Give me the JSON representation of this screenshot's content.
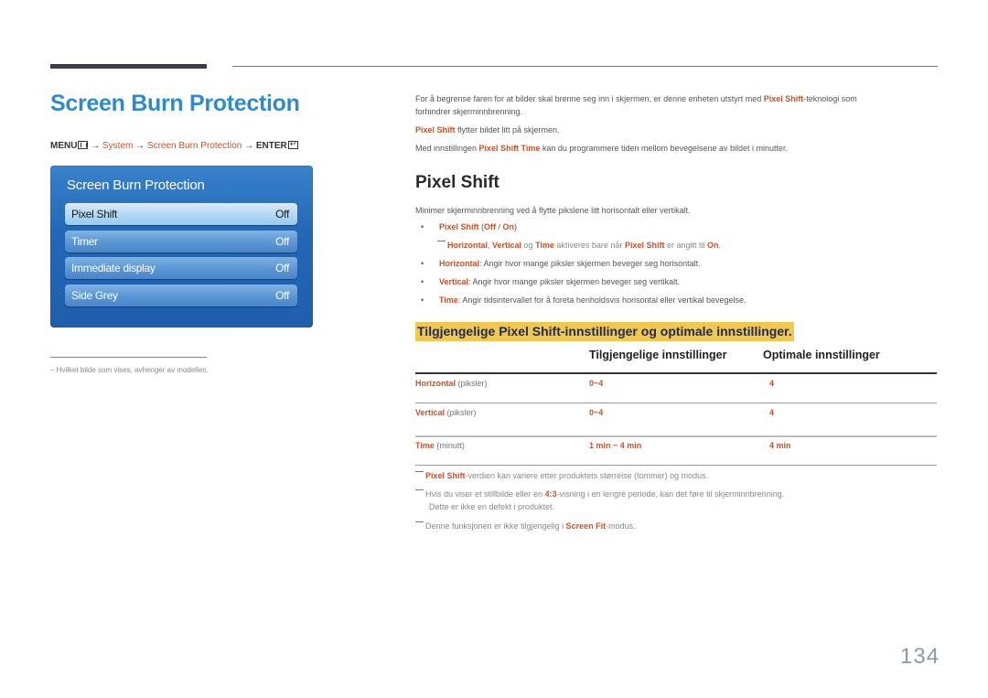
{
  "header": {
    "title": "Screen Burn Protection",
    "menu_path": {
      "menu": "MENU",
      "arrow": "→",
      "system": "System",
      "item": "Screen Burn Protection",
      "enter": "ENTER"
    }
  },
  "osd": {
    "title": "Screen Burn Protection",
    "items": [
      {
        "label": "Pixel Shift",
        "value": "Off",
        "selected": true
      },
      {
        "label": "Timer",
        "value": "Off",
        "selected": false
      },
      {
        "label": "Immediate display",
        "value": "Off",
        "selected": false
      },
      {
        "label": "Side Grey",
        "value": "Off",
        "selected": false
      }
    ]
  },
  "footnote": "Hvilket bilde som vises, avhenger av modellen.",
  "intro": {
    "p1_a": "For å begrense faren for at bilder skal brenne seg inn i skjermen, er denne enheten utstyrt med ",
    "p1_hl": "Pixel Shift",
    "p1_b": "-teknologi som",
    "p1_c": "forhindrer skjerminnbrenning.",
    "p2_hl": "Pixel Shift",
    "p2_b": " flytter bildet litt på skjermen.",
    "p3_a": "Med innstillingen ",
    "p3_hl": "Pixel Shift Time",
    "p3_b": " kan du programmere tiden mellom bevegelsene av bildet i minutter."
  },
  "section": {
    "heading": "Pixel Shift",
    "desc": "Minimer skjerminnbrenning ved å flytte pikslene litt horisontalt eller vertikalt.",
    "option": {
      "name": "Pixel Shift",
      "open": " (",
      "off": "Off",
      "sep": " / ",
      "on": "On",
      "close": ")"
    },
    "note": {
      "h": "Horizontal",
      "c1": ", ",
      "v": "Vertical",
      "og": " og ",
      "t": "Time",
      "mid": " aktiveres bare når ",
      "ps": "Pixel Shift",
      "end": " er angitt til ",
      "on": "On",
      "dot": "."
    },
    "bullets": [
      {
        "term": "Horizontal",
        "text": ": Angir hvor mange piksler skjermen beveger seg horisontalt."
      },
      {
        "term": "Vertical",
        "text": ": Angir hvor mange piksler skjermen beveger seg vertikalt."
      },
      {
        "term": "Time",
        "text": ": Angir tidsintervallet for å foreta henholdsvis horisontal eller vertikal bevegelse."
      }
    ]
  },
  "table": {
    "caption": "Tilgjengelige Pixel Shift-innstillinger og optimale innstillinger.",
    "headers": [
      "",
      "Tilgjengelige innstillinger",
      "Optimale innstillinger"
    ],
    "rows": [
      {
        "name": "Horizontal",
        "unit": " (piksler)",
        "available": "0~4",
        "optimal": "4"
      },
      {
        "name": "Vertical",
        "unit": " (piksler)",
        "available": "0~4",
        "optimal": "4"
      },
      {
        "name": "Time",
        "unit": " (minutt)",
        "available": "1 min ~ 4 min",
        "optimal": "4 min"
      }
    ]
  },
  "notes": {
    "n1_hl": "Pixel Shift",
    "n1_b": "-verdien kan variere etter produktets størrelse (tommer) og modus.",
    "n2_a": "Hvis du viser et stillbilde eller en ",
    "n2_hl": "4:3",
    "n2_b": "-visning i en lengre periode, kan det føre til skjerminnbrenning.",
    "n2_c": "Dette er ikke en defekt i produktet.",
    "n3_a": "Denne funksjonen er ikke tilgjengelig i ",
    "n3_hl": "Screen Fit",
    "n3_b": "-modus."
  },
  "page_number": "134",
  "colors": {
    "accent_orange": "#c7522a",
    "title_blue": "#2b8bd2",
    "banner_yellow": "#f2c74e",
    "osd_blue": "#2268b6"
  }
}
